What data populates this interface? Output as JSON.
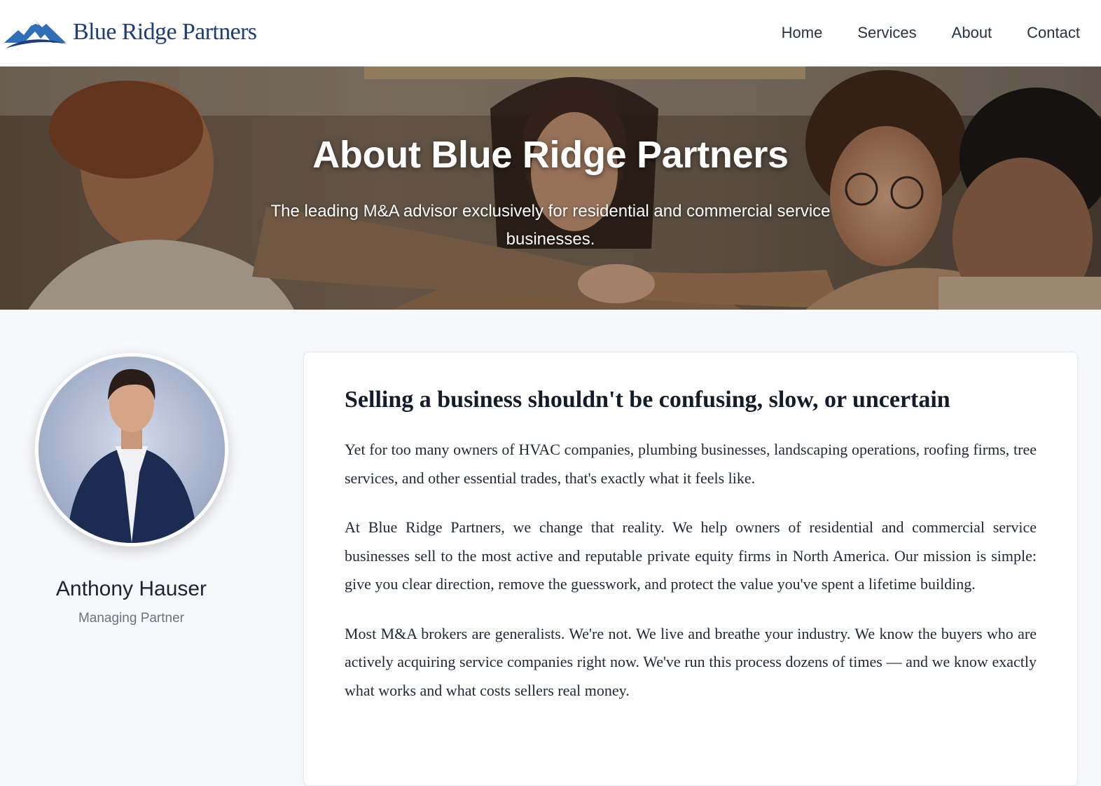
{
  "header": {
    "brand": "Blue Ridge Partners",
    "logo_icon": "mountain-logo-icon",
    "nav": [
      {
        "label": "Home"
      },
      {
        "label": "Services"
      },
      {
        "label": "About"
      },
      {
        "label": "Contact"
      }
    ]
  },
  "hero": {
    "title": "About Blue Ridge Partners",
    "subtitle": "The leading M&A advisor exclusively for residential and commercial service businesses."
  },
  "profile": {
    "name": "Anthony Hauser",
    "role": "Managing Partner"
  },
  "content": {
    "heading": "Selling a business shouldn't be confusing, slow, or uncertain",
    "paragraphs": [
      "Yet for too many owners of HVAC companies, plumbing businesses, landscaping operations, roofing firms, tree services, and other essential trades, that's exactly what it feels like.",
      "At Blue Ridge Partners, we change that reality. We help owners of residential and commercial service businesses sell to the most active and reputable private equity firms in North America. Our mission is simple: give you clear direction, remove the guesswork, and protect the value you've spent a lifetime building.",
      "Most M&A brokers are generalists. We're not. We live and breathe your industry. We know the buyers who are actively acquiring service companies right now. We've run this process dozens of times — and we know exactly what works and what costs sellers real money."
    ]
  },
  "colors": {
    "brand_navy": "#1f3d7a",
    "logo_blue": "#2b6cb0",
    "page_bg": "#f7f8fa"
  }
}
